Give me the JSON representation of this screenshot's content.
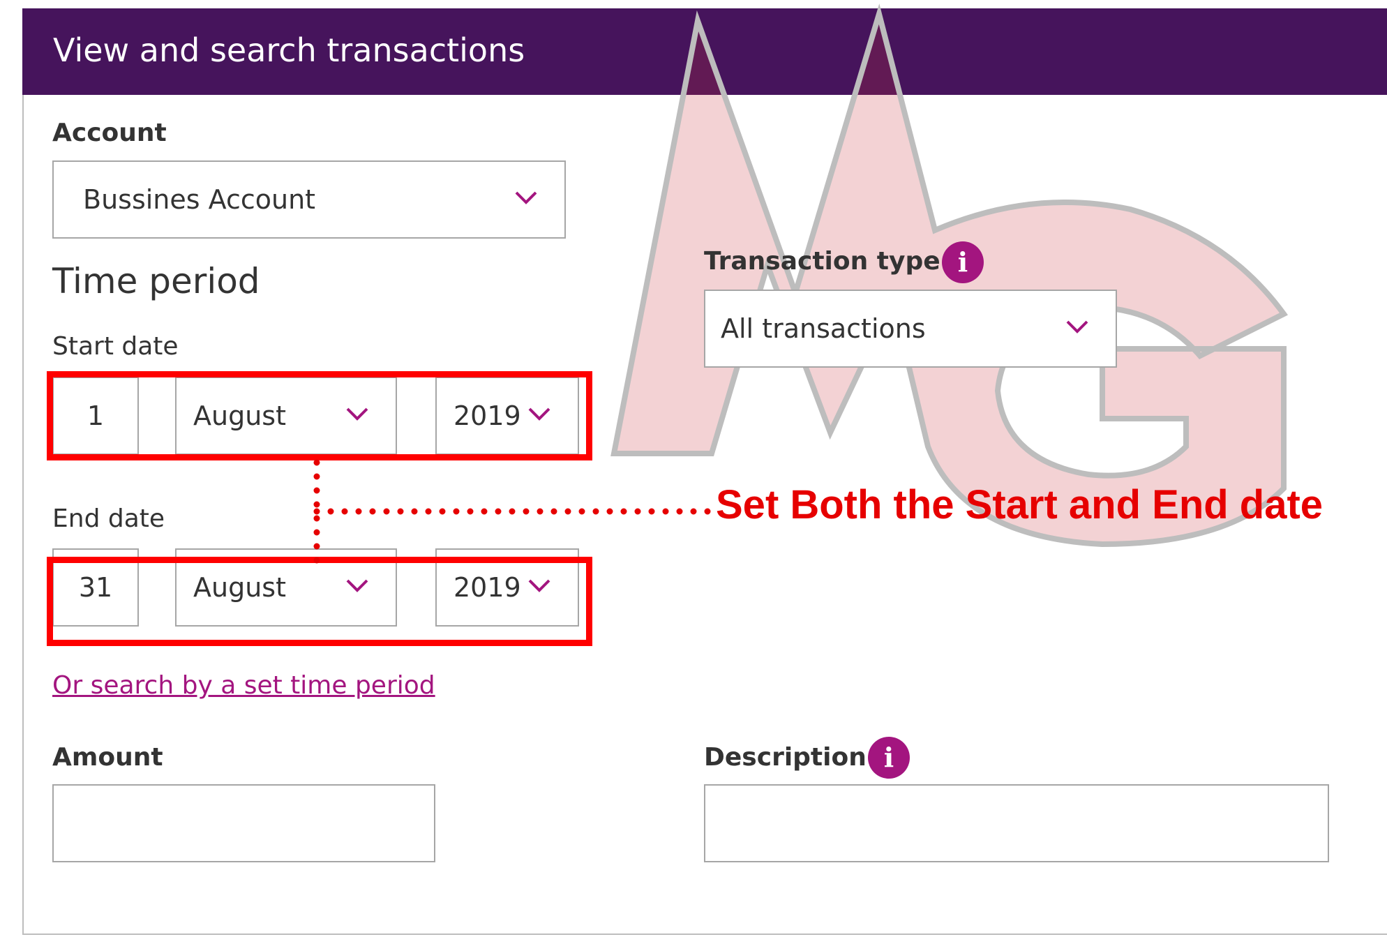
{
  "header": {
    "title": "View and search transactions"
  },
  "account": {
    "label": "Account",
    "selected": "Bussines Account"
  },
  "time_period": {
    "heading": "Time period",
    "start_label": "Start date",
    "start_day": "1",
    "start_month": "August",
    "start_year": "2019",
    "end_label": "End date",
    "end_day": "31",
    "end_month": "August",
    "end_year": "2019",
    "set_period_link": "Or search by a set time period"
  },
  "transaction_type": {
    "label": "Transaction type",
    "selected": "All transactions"
  },
  "amount": {
    "label": "Amount",
    "value": ""
  },
  "description": {
    "label": "Description",
    "value": ""
  },
  "annotation": {
    "text": "Set Both the Start and End date"
  },
  "watermark": {
    "text": "MG"
  },
  "colors": {
    "header_bg": "#46145c",
    "accent": "#a3157f",
    "annotation_red": "#ff0000"
  },
  "icons": {
    "dropdown": "chevron-down-icon",
    "info": "info-icon"
  }
}
